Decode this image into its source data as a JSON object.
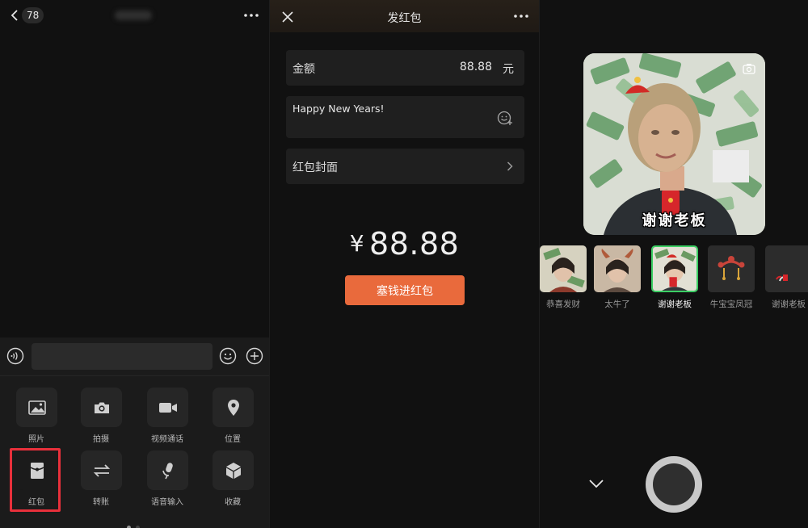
{
  "chat": {
    "badge": "78",
    "input_value": "",
    "grid": [
      {
        "label": "照片",
        "icon": "photo-icon"
      },
      {
        "label": "拍摄",
        "icon": "camera-icon"
      },
      {
        "label": "视频通话",
        "icon": "video-call-icon"
      },
      {
        "label": "位置",
        "icon": "location-icon"
      },
      {
        "label": "红包",
        "icon": "red-packet-icon"
      },
      {
        "label": "转账",
        "icon": "transfer-icon"
      },
      {
        "label": "语音输入",
        "icon": "microphone-icon"
      },
      {
        "label": "收藏",
        "icon": "favorites-icon"
      }
    ],
    "highlight_color": "#e8303b"
  },
  "packet": {
    "title": "发红包",
    "amount_label": "金额",
    "amount_value": "88.88",
    "amount_unit": "元",
    "greeting": "Happy New Years!",
    "cover_label": "红包封面",
    "big_amount_symbol": "¥",
    "big_amount": "88.88",
    "send_button": "塞钱进红包",
    "accent": "#e96a3c"
  },
  "camera": {
    "preview_caption": "谢谢老板",
    "effects": [
      {
        "label": "恭喜发财",
        "selected": false
      },
      {
        "label": "太牛了",
        "selected": false
      },
      {
        "label": "谢谢老板",
        "selected": true
      },
      {
        "label": "牛宝宝凤冠",
        "selected": false
      },
      {
        "label": "谢谢老板",
        "selected": false
      }
    ],
    "selected_color": "#3ccf64"
  }
}
